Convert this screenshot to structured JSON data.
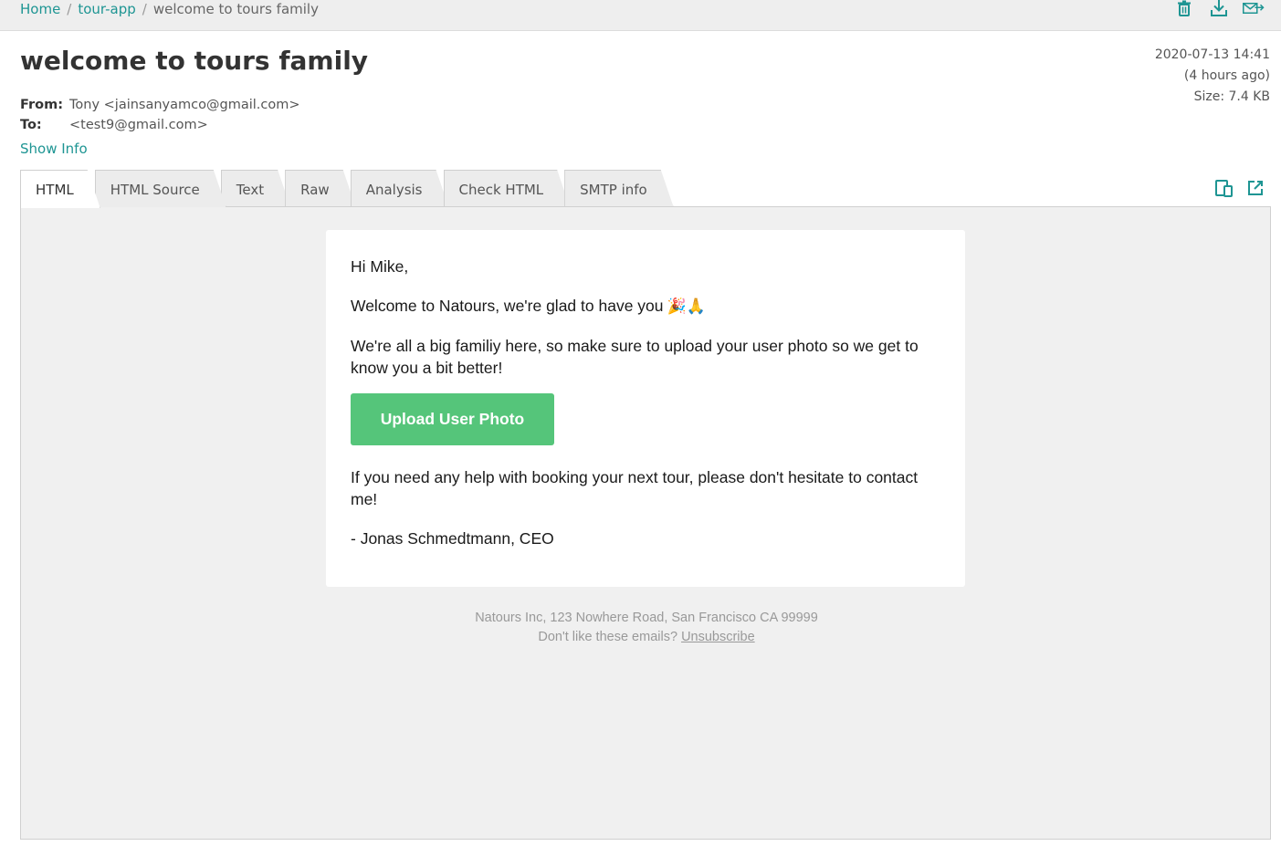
{
  "breadcrumb": {
    "home": "Home",
    "app": "tour-app",
    "current": "welcome to tours family",
    "separator": "/"
  },
  "toolbar": {
    "icons": [
      "trash-icon",
      "download-icon",
      "forward-mail-icon"
    ]
  },
  "message": {
    "subject": "welcome to tours family",
    "from_label": "From:",
    "from_value": "Tony <jainsanyamco@gmail.com>",
    "to_label": "To:",
    "to_value": "<test9@gmail.com>",
    "show_info": "Show Info",
    "date": "2020-07-13 14:41",
    "relative": "(4 hours ago)",
    "size": "Size: 7.4 KB"
  },
  "tabs": [
    {
      "label": "HTML",
      "active": true
    },
    {
      "label": "HTML Source",
      "active": false
    },
    {
      "label": "Text",
      "active": false
    },
    {
      "label": "Raw",
      "active": false
    },
    {
      "label": "Analysis",
      "active": false
    },
    {
      "label": "Check HTML",
      "active": false
    },
    {
      "label": "SMTP info",
      "active": false
    }
  ],
  "view_icons": [
    "mobile-view-icon",
    "open-new-window-icon"
  ],
  "email": {
    "greeting": "Hi Mike,",
    "welcome": "Welcome to Natours, we're glad to have you",
    "welcome_emoji": "🎉🙏",
    "family": "We're all a big familiy here, so make sure to upload your user photo so we get to know you a bit better!",
    "cta": "Upload User Photo",
    "help": "If you need any help with booking your next tour, please don't hesitate to contact me!",
    "signature": "- Jonas Schmedtmann, CEO",
    "footer_address": "Natours Inc, 123 Nowhere Road, San Francisco CA 99999",
    "footer_prompt": "Don't like these emails?",
    "unsubscribe": "Unsubscribe"
  },
  "colors": {
    "accent": "#1e9593",
    "cta": "#55c57a",
    "preview_bg": "#f0f0f0"
  }
}
